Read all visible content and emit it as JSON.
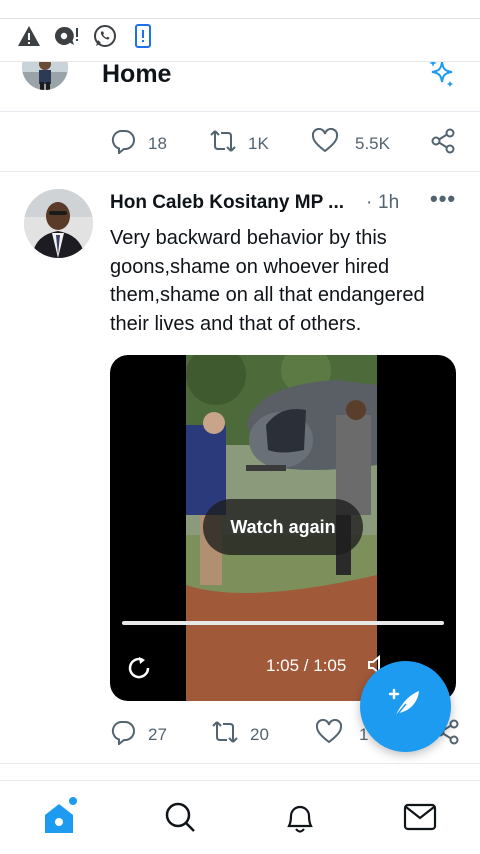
{
  "status_bar": {
    "icons": [
      "warning-icon",
      "chat-alert-icon",
      "whatsapp-icon",
      "phone-alert-icon"
    ]
  },
  "header": {
    "title": "Home",
    "sparkle_icon": "sparkle-icon"
  },
  "previous_tweet": {
    "replies": "18",
    "retweets": "1K",
    "likes": "5.5K"
  },
  "tweet": {
    "author": "Hon Caleb Kositany MP ...",
    "separator": "·",
    "time": "1h",
    "more": "•••",
    "text": "Very backward behavior by this goons,shame on whoever hired them,shame on all that endangered their lives and that of others.",
    "video": {
      "watch_again_label": "Watch again",
      "time_display": "1:05 / 1:05",
      "progress": 1.0
    },
    "replies": "27",
    "retweets": "20",
    "likes": "1"
  },
  "nav": {
    "items": [
      "home-icon",
      "search-icon",
      "notifications-icon",
      "messages-icon"
    ],
    "active": "home"
  },
  "colors": {
    "accent": "#1d9bf0",
    "text_primary": "#0f1419",
    "text_secondary": "#536471"
  }
}
